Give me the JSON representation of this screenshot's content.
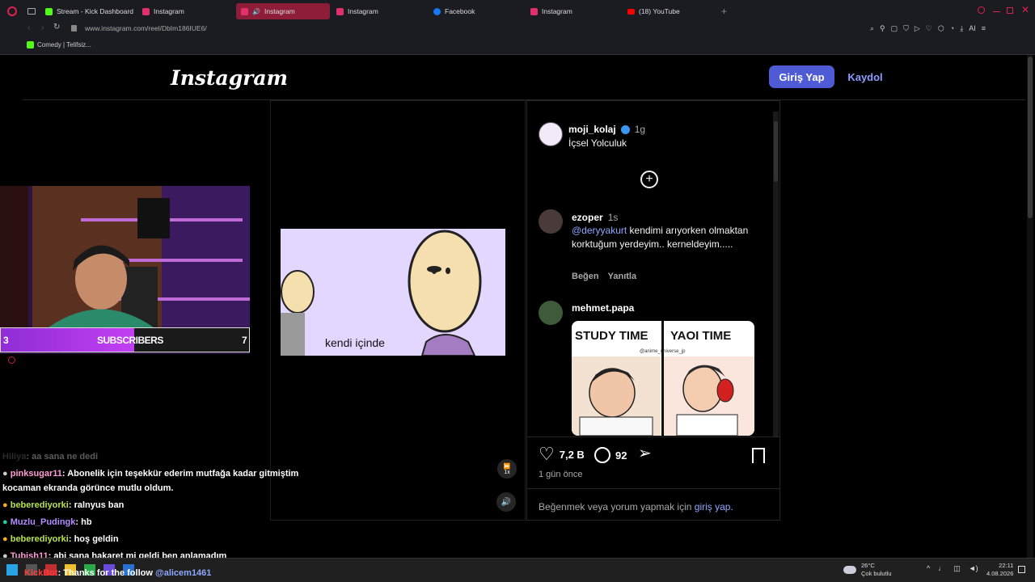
{
  "browser": {
    "tabs": [
      {
        "label": "Stream - Kick Dashboard",
        "icon": "kick-icon",
        "color": "#53fc18"
      },
      {
        "label": "Instagram",
        "icon": "instagram-icon",
        "color": "#e1306c"
      },
      {
        "label": "Instagram",
        "icon": "instagram-icon",
        "color": "#e1306c",
        "active": true
      },
      {
        "label": "Instagram",
        "icon": "instagram-icon",
        "color": "#e1306c"
      },
      {
        "label": "Facebook",
        "icon": "facebook-icon",
        "color": "#1877f2"
      },
      {
        "label": "Instagram",
        "icon": "instagram-icon",
        "color": "#e1306c"
      },
      {
        "label": "(18) YouTube",
        "icon": "youtube-icon",
        "color": "#ff0000"
      }
    ],
    "url": "www.instagram.com/reel/DbIm186IUE6/",
    "bookmark": "Comedy | Telifsiz..."
  },
  "instagram": {
    "logo": "Instagram",
    "login": "Giriş Yap",
    "signup": "Kaydol"
  },
  "video": {
    "caption": "kendi içinde",
    "speed": "1x"
  },
  "post": {
    "author": "moji_kolaj",
    "author_time": "1g",
    "caption": "İçsel Yolculuk",
    "comments": [
      {
        "user": "ezoper",
        "time": "1s",
        "mention": "@deryyakurt",
        "text": "kendimi arıyorken olmaktan korktuğum yerdeyim.. kerneldeyim.....",
        "like": "Beğen",
        "reply": "Yanıtla"
      },
      {
        "user": "mehmet.papa",
        "meme_left": "STUDY TIME",
        "meme_right": "YAOI TIME",
        "meme_credit": "@anime_universe_jp"
      }
    ],
    "likes": "7,2 B",
    "comment_count": "92",
    "posted": "1 gün önce",
    "login_prompt": "Beğenmek veya yorum yapmak için",
    "login_link": "giriş yap."
  },
  "stream": {
    "subs_left": "3",
    "subs_label": "SUBSCRIBERS",
    "subs_right": "7"
  },
  "chat": [
    {
      "user": "Hiliya",
      "text": ": aa sana ne dedi",
      "color": "#555555"
    },
    {
      "user": "pinksugar11",
      "text": ": Abonelik için teşekkür ederim mutfağa kadar gitmiştim",
      "color": "#ff9bd6"
    },
    {
      "user": "",
      "text": "kocaman ekranda görünce mutlu oldum.",
      "color": "#ffffff"
    },
    {
      "user": "beberediyorki",
      "text": ": ralnyus ban",
      "color": "#b6e24a"
    },
    {
      "user": "Muzlu_Pudingk",
      "text": ": hb",
      "color": "#b48cff"
    },
    {
      "user": "beberediyorki",
      "text": ": hoş geldin",
      "color": "#b6e24a"
    },
    {
      "user": "Tubish11",
      "text": ": abi sana hakaret mi geldi ben anlamadım",
      "color": "#ff9bd6"
    },
    {
      "user": "KickBot",
      "text": ": Thanks for the follow",
      "mention": "@alicem1461",
      "color": "#ff3b3b"
    }
  ],
  "taskbar": {
    "weather_temp": "26°C",
    "weather_desc": "Çok bulutlu",
    "time": "22:11",
    "date": "4.08.2026"
  }
}
